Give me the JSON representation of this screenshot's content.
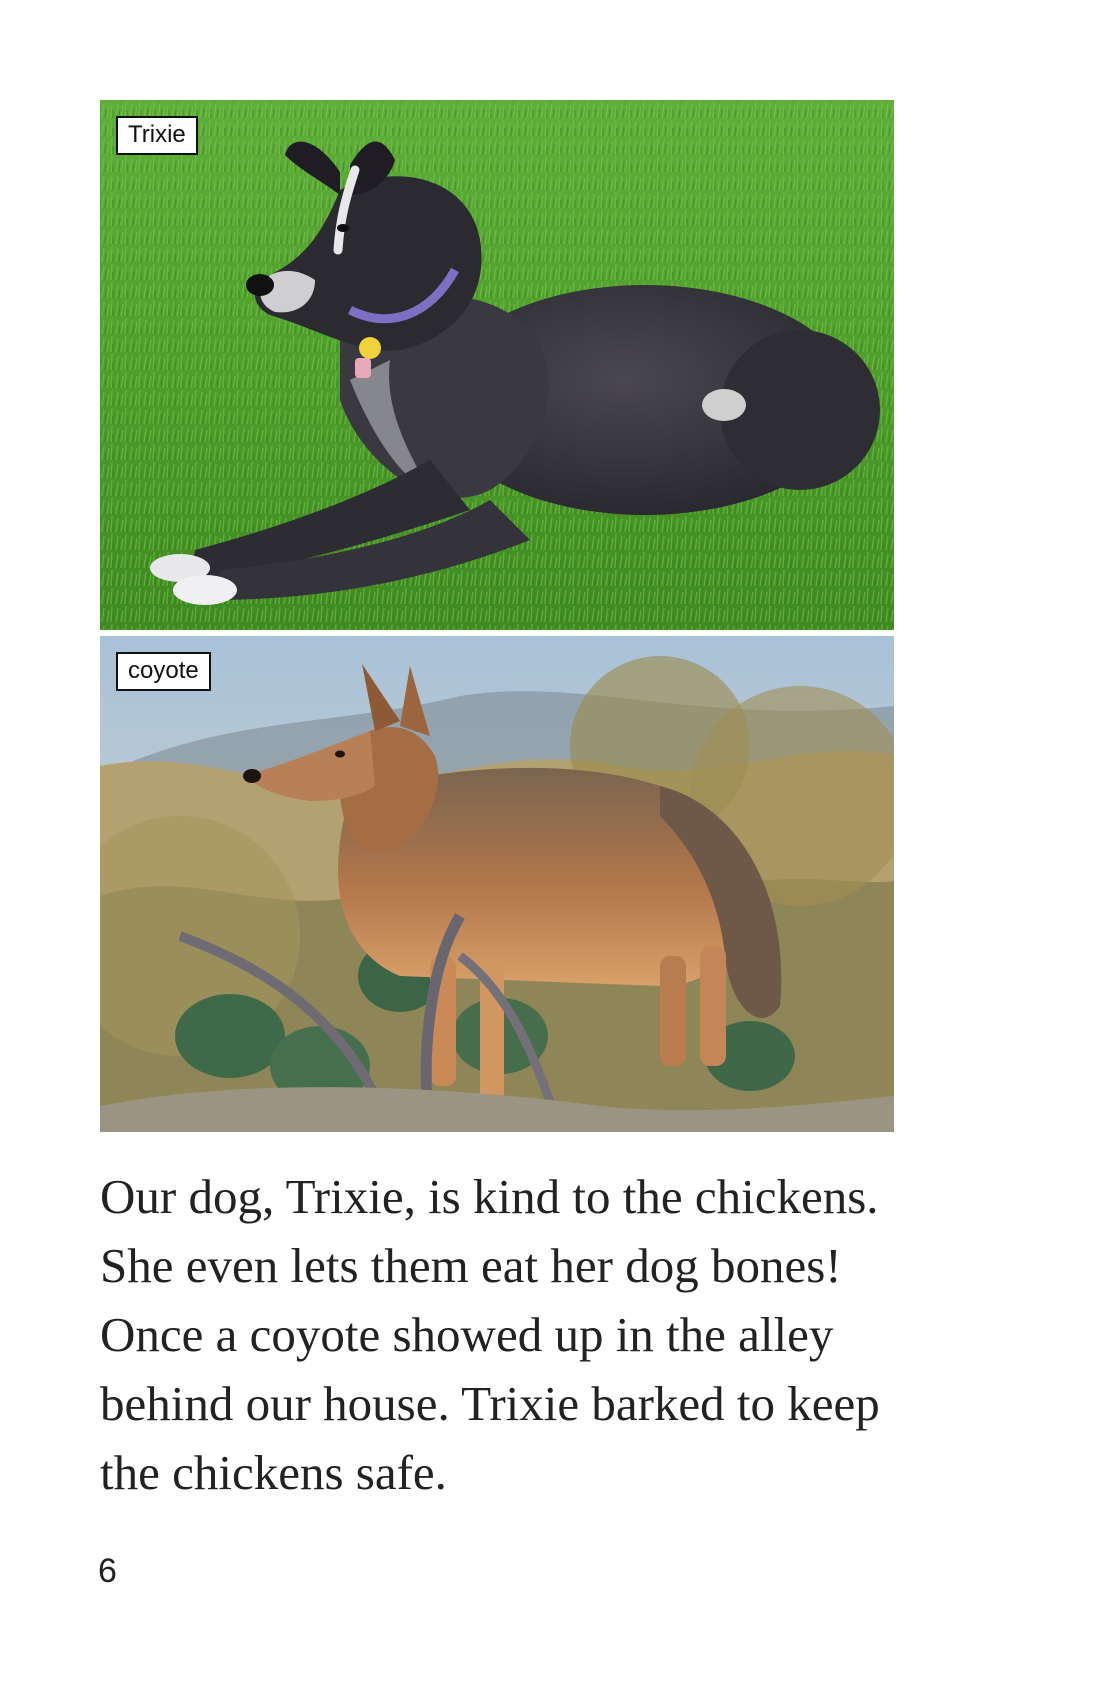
{
  "photos": [
    {
      "label": "Trixie"
    },
    {
      "label": "coyote"
    }
  ],
  "body_text": "Our dog, Trixie, is kind to the chickens. She even lets them eat her dog bones! Once a coyote showed up in the alley behind our house. Trixie barked to keep the chickens safe.",
  "page_number": "6"
}
